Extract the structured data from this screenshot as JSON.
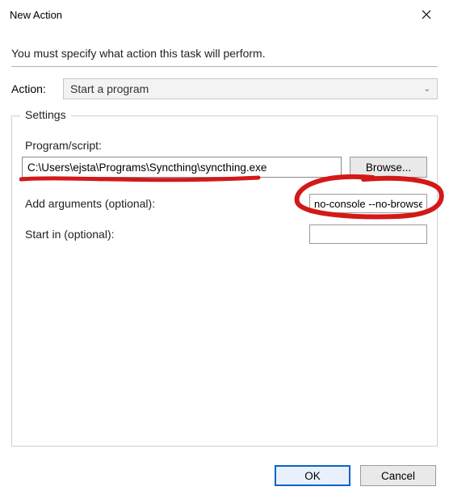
{
  "window": {
    "title": "New Action"
  },
  "instruction": "You must specify what action this task will perform.",
  "action": {
    "label": "Action:",
    "selected": "Start a program"
  },
  "settings": {
    "legend": "Settings",
    "program_label": "Program/script:",
    "program_value": "C:\\Users\\ejsta\\Programs\\Syncthing\\syncthing.exe",
    "browse_label": "Browse...",
    "args_label": "Add arguments (optional):",
    "args_value": "no-console --no-browser",
    "startin_label": "Start in (optional):",
    "startin_value": ""
  },
  "footer": {
    "ok": "OK",
    "cancel": "Cancel"
  }
}
